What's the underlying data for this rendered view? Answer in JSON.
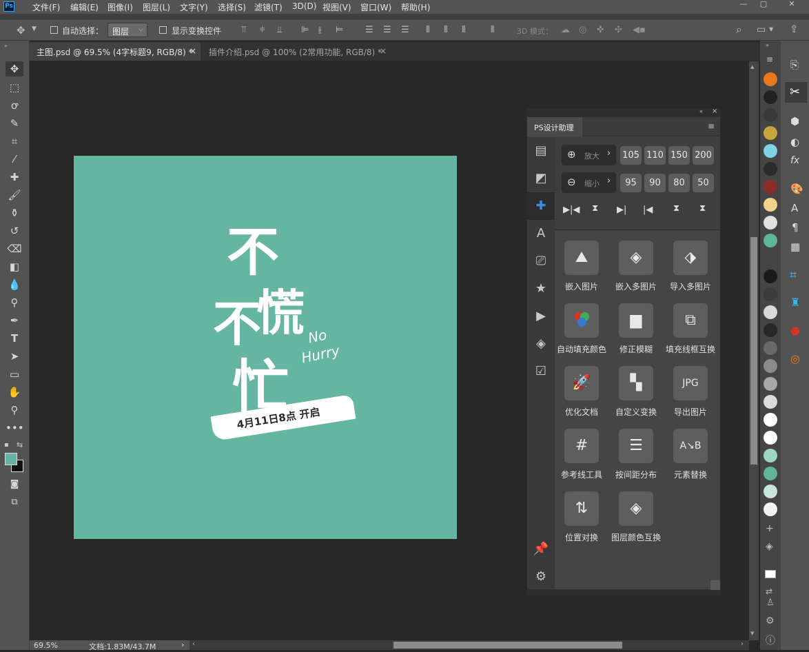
{
  "app": {
    "logo": "Ps"
  },
  "menu": [
    "文件(F)",
    "编辑(E)",
    "图像(I)",
    "图层(L)",
    "文字(Y)",
    "选择(S)",
    "滤镜(T)",
    "3D(D)",
    "视图(V)",
    "窗口(W)",
    "帮助(H)"
  ],
  "options": {
    "auto_select_label": "自动选择：",
    "layer_select_value": "图层",
    "show_transform_label": "显示变换控件",
    "mode_3d_label": "3D 模式："
  },
  "tabs": [
    {
      "label": "主图.psd @ 69.5% (4字标题9, RGB/8) *",
      "close": "×",
      "active": true
    },
    {
      "label": "插件介绍.psd @ 100% (2常用功能, RGB/8) *",
      "close": "×",
      "active": false
    }
  ],
  "status": {
    "zoom": "69.5%",
    "doc_info": "文档:1.83M/43.7M",
    "arrow": "›"
  },
  "canvas": {
    "bg_color": "#65b6a0",
    "title_line1": "不",
    "title_line2a": "不",
    "title_line2b": "慌",
    "title_line3": "忙",
    "english_line1": "No",
    "english_line2": "Hurry",
    "banner": "4月11日8点 开启"
  },
  "plugin": {
    "title": "PS设计助理",
    "zoom_in_label": "放大",
    "zoom_out_label": "缩小",
    "zoom_in_values": [
      "105",
      "110",
      "150",
      "200"
    ],
    "zoom_out_values": [
      "95",
      "90",
      "80",
      "50"
    ],
    "functions": [
      {
        "label": "嵌入图片",
        "icon": "mountain-icon"
      },
      {
        "label": "嵌入多图片",
        "icon": "layers-icon"
      },
      {
        "label": "导入多图片",
        "icon": "import-icon"
      },
      {
        "label": "自动填充颜色",
        "icon": "color-circles-icon"
      },
      {
        "label": "修正模糊",
        "icon": "square-icon"
      },
      {
        "label": "填充线框互换",
        "icon": "swap-square-icon"
      },
      {
        "label": "优化文档",
        "icon": "rocket-icon"
      },
      {
        "label": "自定义变换",
        "icon": "transform-icon"
      },
      {
        "label": "导出图片",
        "icon": "jpg-icon",
        "text": "JPG"
      },
      {
        "label": "参考线工具",
        "icon": "grid-icon"
      },
      {
        "label": "按间距分布",
        "icon": "distribute-icon"
      },
      {
        "label": "元素替换",
        "icon": "ab-icon"
      },
      {
        "label": "位置对换",
        "icon": "position-swap-icon"
      },
      {
        "label": "图层颜色互换",
        "icon": "layer-color-icon"
      }
    ]
  },
  "swatches": [
    "#e9781d",
    "#222222",
    "#3a3a3a",
    "#c9a43a",
    "#7fd3e3",
    "#2b2b2b",
    "#8b2e2a",
    "#f0d28c",
    "#e0e0e0",
    "#5fb49d",
    "#1a1a1a",
    "#3c3c3c",
    "#d8d8d8",
    "#282828",
    "#6a6a6a",
    "#8a8a8a",
    "#a8a8a8",
    "#dcdcdc",
    "#ffffff",
    "#ffffff",
    "#9ed6c6",
    "#5fb49d",
    "#c8e6dc",
    "#f2f2f2"
  ]
}
